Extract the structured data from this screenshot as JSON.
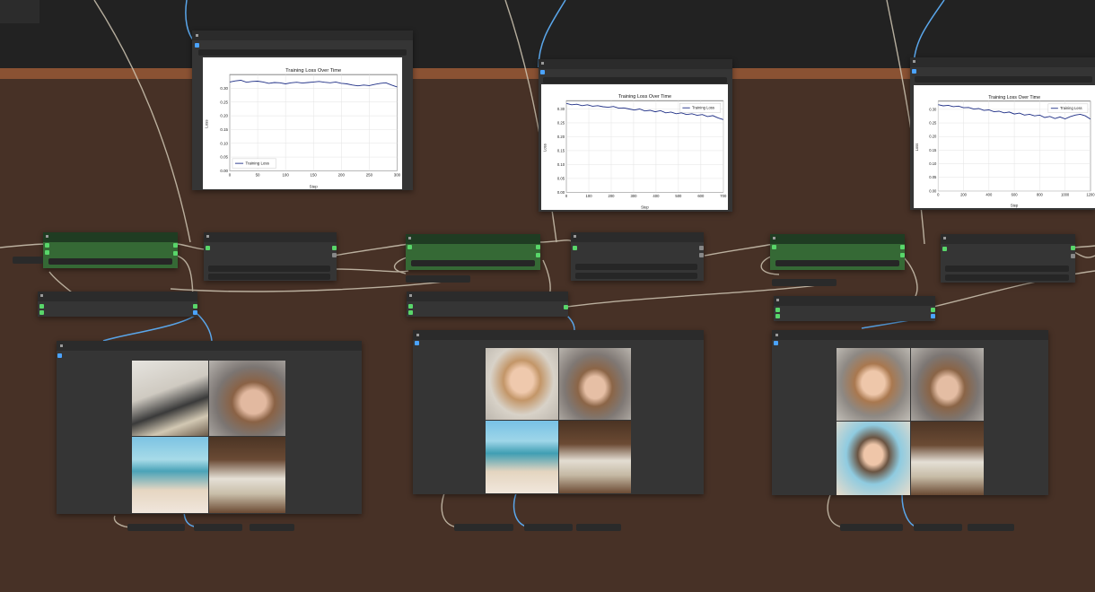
{
  "chart_data": [
    {
      "type": "line",
      "title": "Training Loss Over Time",
      "xlabel": "Step",
      "ylabel": "Loss",
      "series": [
        {
          "name": "Training Loss",
          "values": [
            0.323,
            0.327,
            0.329,
            0.322,
            0.325,
            0.326,
            0.323,
            0.318,
            0.321,
            0.32,
            0.316,
            0.32,
            0.322,
            0.319,
            0.321,
            0.323,
            0.325,
            0.322,
            0.32,
            0.323,
            0.318,
            0.316,
            0.312,
            0.309,
            0.312,
            0.31,
            0.314,
            0.318,
            0.32,
            0.312,
            0.305
          ]
        }
      ],
      "x_range": [
        0,
        300
      ],
      "ylim": [
        0,
        0.35
      ],
      "xticks": [
        "0",
        "50",
        "100",
        "150",
        "200",
        "250",
        "300"
      ],
      "yticks": [
        "0.00",
        "0.05",
        "0.10",
        "0.15",
        "0.20",
        "0.25",
        "0.30"
      ],
      "legend": "lower-left"
    },
    {
      "type": "line",
      "title": "Training Loss Over Time",
      "xlabel": "Step",
      "ylabel": "Loss",
      "series": [
        {
          "name": "Training Loss",
          "values": [
            0.32,
            0.315,
            0.317,
            0.312,
            0.315,
            0.31,
            0.312,
            0.308,
            0.306,
            0.309,
            0.303,
            0.304,
            0.3,
            0.296,
            0.3,
            0.293,
            0.295,
            0.29,
            0.294,
            0.286,
            0.289,
            0.283,
            0.286,
            0.28,
            0.283,
            0.277,
            0.28,
            0.273,
            0.276,
            0.268,
            0.262
          ]
        }
      ],
      "x_range": [
        0,
        700
      ],
      "ylim": [
        0,
        0.33
      ],
      "xticks": [
        "0",
        "100",
        "200",
        "300",
        "400",
        "500",
        "600",
        "700"
      ],
      "yticks": [
        "0.00",
        "0.05",
        "0.10",
        "0.15",
        "0.20",
        "0.25",
        "0.30"
      ],
      "legend": "top-right"
    },
    {
      "type": "line",
      "title": "Training Loss Over Time",
      "xlabel": "Step",
      "ylabel": "Loss",
      "series": [
        {
          "name": "Training Loss",
          "values": [
            0.317,
            0.313,
            0.315,
            0.31,
            0.312,
            0.306,
            0.307,
            0.301,
            0.303,
            0.296,
            0.298,
            0.291,
            0.293,
            0.287,
            0.29,
            0.283,
            0.286,
            0.279,
            0.282,
            0.276,
            0.279,
            0.27,
            0.274,
            0.266,
            0.272,
            0.265,
            0.273,
            0.279,
            0.282,
            0.276,
            0.264
          ]
        }
      ],
      "x_range": [
        0,
        1200
      ],
      "ylim": [
        0,
        0.33
      ],
      "xticks": [
        "0",
        "200",
        "400",
        "600",
        "800",
        "1000",
        "1200"
      ],
      "yticks": [
        "0.00",
        "0.05",
        "0.10",
        "0.15",
        "0.20",
        "0.25",
        "0.30"
      ],
      "legend": "top-right"
    }
  ],
  "colors": {
    "canvas_brown": "#473126",
    "canvas_top": "#222222",
    "canvas_strip": "#8a5233",
    "node_bg": "#353535",
    "node_green": "#356935",
    "link_blue": "#5aa6ea",
    "link_beige": "#cfc6b3",
    "loss_line": "#1f2f86"
  },
  "icons": [
    "close-icon"
  ]
}
